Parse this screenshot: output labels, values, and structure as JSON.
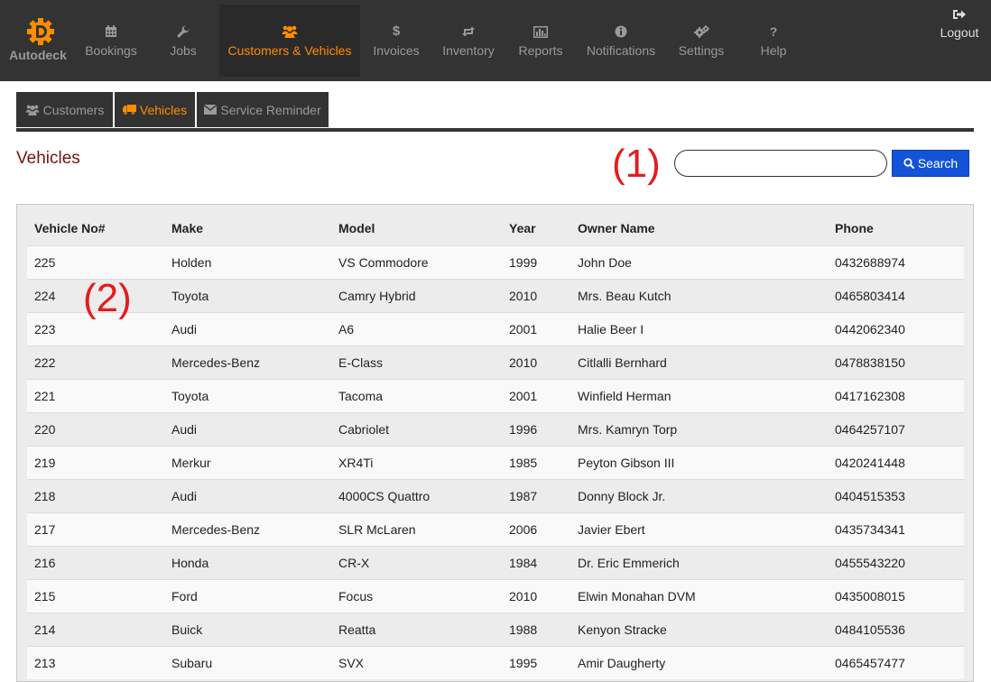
{
  "brand": {
    "name": "Autodeck",
    "icon": "autodeck-gear-icon",
    "accent": "#ff8c00"
  },
  "nav": [
    {
      "key": "bookings",
      "label": "Bookings",
      "icon": "calendar-icon"
    },
    {
      "key": "jobs",
      "label": "Jobs",
      "icon": "wrench-icon"
    },
    {
      "key": "customers",
      "label": "Customers & Vehicles",
      "icon": "users-icon",
      "active": true
    },
    {
      "key": "invoices",
      "label": "Invoices",
      "icon": "dollar-icon"
    },
    {
      "key": "inventory",
      "label": "Inventory",
      "icon": "retweet-icon"
    },
    {
      "key": "reports",
      "label": "Reports",
      "icon": "bar-chart-icon"
    },
    {
      "key": "notifications",
      "label": "Notifications",
      "icon": "info-icon"
    },
    {
      "key": "settings",
      "label": "Settings",
      "icon": "gears-icon"
    },
    {
      "key": "help",
      "label": "Help",
      "icon": "question-icon"
    }
  ],
  "logout": {
    "label": "Logout",
    "icon": "sign-out-icon"
  },
  "subtabs": [
    {
      "label": "Customers",
      "icon": "users-icon"
    },
    {
      "label": "Vehicles",
      "icon": "truck-icon",
      "active": true
    },
    {
      "label": "Service Reminder",
      "icon": "envelope-icon"
    }
  ],
  "page": {
    "title": "Vehicles"
  },
  "annotations": {
    "one": "(1)",
    "two": "(2)"
  },
  "search": {
    "value": "",
    "placeholder": "",
    "button_label": "Search",
    "button_color": "#1353d8"
  },
  "table": {
    "columns": [
      "Vehicle No#",
      "Make",
      "Model",
      "Year",
      "Owner Name",
      "Phone"
    ],
    "rows": [
      [
        "225",
        "Holden",
        "VS Commodore",
        "1999",
        "John Doe",
        "0432688974"
      ],
      [
        "224",
        "Toyota",
        "Camry Hybrid",
        "2010",
        "Mrs. Beau Kutch",
        "0465803414"
      ],
      [
        "223",
        "Audi",
        "A6",
        "2001",
        "Halie Beer I",
        "0442062340"
      ],
      [
        "222",
        "Mercedes-Benz",
        "E-Class",
        "2010",
        "Citlalli Bernhard",
        "0478838150"
      ],
      [
        "221",
        "Toyota",
        "Tacoma",
        "2001",
        "Winfield Herman",
        "0417162308"
      ],
      [
        "220",
        "Audi",
        "Cabriolet",
        "1996",
        "Mrs. Kamryn Torp",
        "0464257107"
      ],
      [
        "219",
        "Merkur",
        "XR4Ti",
        "1985",
        "Peyton Gibson III",
        "0420241448"
      ],
      [
        "218",
        "Audi",
        "4000CS Quattro",
        "1987",
        "Donny Block Jr.",
        "0404515353"
      ],
      [
        "217",
        "Mercedes-Benz",
        "SLR McLaren",
        "2006",
        "Javier Ebert",
        "0435734341"
      ],
      [
        "216",
        "Honda",
        "CR-X",
        "1984",
        "Dr. Eric Emmerich",
        "0455543220"
      ],
      [
        "215",
        "Ford",
        "Focus",
        "2010",
        "Elwin Monahan DVM",
        "0435008015"
      ],
      [
        "214",
        "Buick",
        "Reatta",
        "1988",
        "Kenyon Stracke",
        "0484105536"
      ],
      [
        "213",
        "Subaru",
        "SVX",
        "1995",
        "Amir Daugherty",
        "0465457477"
      ]
    ]
  }
}
